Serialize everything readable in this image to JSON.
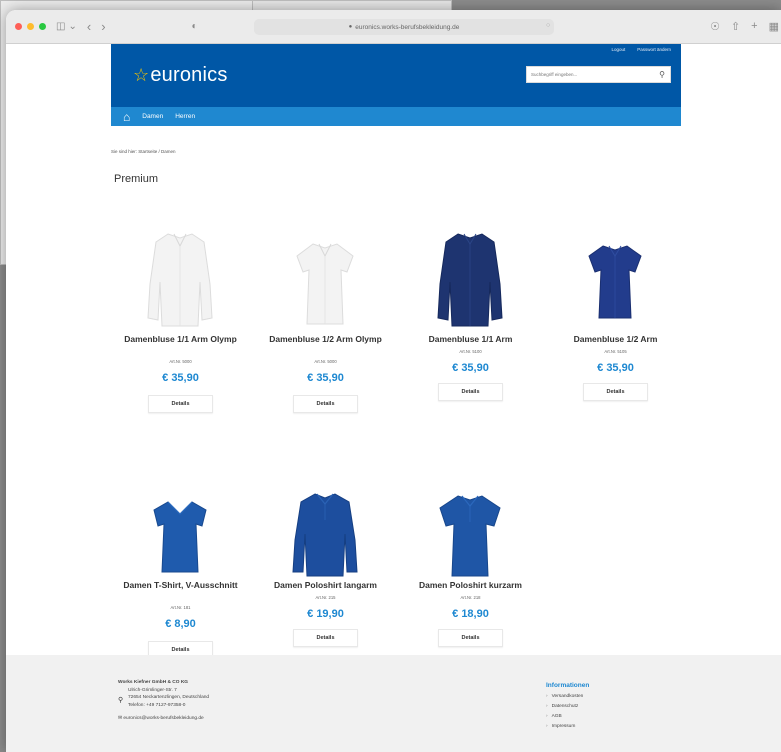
{
  "browser": {
    "url": "euronics.works-berufsbekleidung.de"
  },
  "header": {
    "brand": "euronics",
    "top_links": [
      "Logout",
      "Passwort ändern"
    ],
    "search_placeholder": "Suchbegriff eingeben...",
    "nav": [
      "Damen",
      "Herren"
    ],
    "colors": {
      "header_bg": "#0057a6",
      "nav_bg": "#1f88d0",
      "logo_star": "#f7c400",
      "price": "#1e88d1"
    }
  },
  "breadcrumb": "Sie sind hier: Startseite / Damen",
  "page_title": "Premium",
  "products": [
    {
      "name": "Damenbluse 1/1 Arm Olymp",
      "art": "Art.Nr. 5000",
      "price": "€ 35,90",
      "button": "Details",
      "image": "white-long-sleeve-blouse"
    },
    {
      "name": "Damenbluse 1/2 Arm Olymp",
      "art": "Art.Nr. 5000",
      "price": "€ 35,90",
      "button": "Details",
      "image": "white-short-sleeve-blouse"
    },
    {
      "name": "Damenbluse 1/1 Arm",
      "art": "Art.Nr. 5100",
      "price": "€ 35,90",
      "button": "Details",
      "image": "navy-long-sleeve-blouse"
    },
    {
      "name": "Damenbluse 1/2 Arm",
      "art": "Art.Nr. 5105",
      "price": "€ 35,90",
      "button": "Details",
      "image": "navy-short-sleeve-blouse"
    },
    {
      "name": "Damen T-Shirt, V-Ausschnitt",
      "art": "Art.Nr. 181",
      "price": "€ 8,90",
      "button": "Details",
      "image": "blue-v-neck-tshirt"
    },
    {
      "name": "Damen Poloshirt langarm",
      "art": "Art.Nr. 215",
      "price": "€ 19,90",
      "button": "Details",
      "image": "blue-long-sleeve-polo"
    },
    {
      "name": "Damen Poloshirt kurzarm",
      "art": "Art.Nr. 218",
      "price": "€ 18,90",
      "button": "Details",
      "image": "blue-short-sleeve-polo"
    }
  ],
  "footer": {
    "company": {
      "name": "Works Kiefner GmbH & CO KG",
      "street": "Ulrich-Grimlinger-Str. 7",
      "city": "72654 Neckartenzlingen, Deutschland",
      "phone": "Telefon: +49 7127-97358-0",
      "email": "euronics@works-berufsbekleidung.de"
    },
    "info_title": "Informationen",
    "info_links": [
      "Versandkosten",
      "Datenschutz",
      "AGB",
      "Impressum"
    ]
  }
}
